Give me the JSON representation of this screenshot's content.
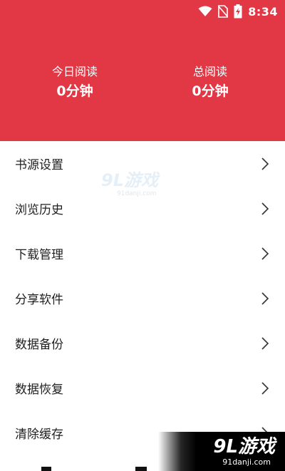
{
  "status_bar": {
    "time": "8:34",
    "icons": [
      "wifi-icon",
      "no-sim-icon",
      "battery-charging-icon"
    ]
  },
  "header": {
    "background": "#e23744",
    "stats": [
      {
        "label": "今日阅读",
        "value": "0分钟"
      },
      {
        "label": "总阅读",
        "value": "0分钟"
      }
    ]
  },
  "menu": {
    "items": [
      {
        "label": "书源设置",
        "icon": "chevron-right-icon"
      },
      {
        "label": "浏览历史",
        "icon": "chevron-right-icon"
      },
      {
        "label": "下载管理",
        "icon": "chevron-right-icon"
      },
      {
        "label": "分享软件",
        "icon": "chevron-right-icon"
      },
      {
        "label": "数据备份",
        "icon": "chevron-right-icon"
      },
      {
        "label": "数据恢复",
        "icon": "chevron-right-icon"
      },
      {
        "label": "清除缓存",
        "icon": "chevron-right-icon"
      }
    ]
  },
  "watermark": {
    "logo": "9L游戏",
    "site": "91danji.com"
  }
}
